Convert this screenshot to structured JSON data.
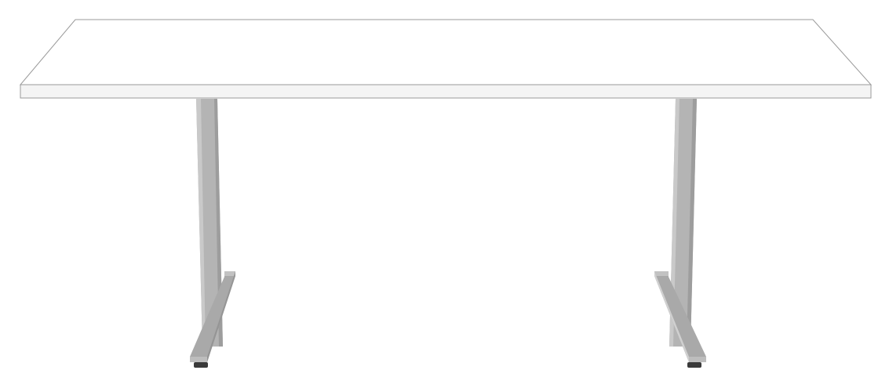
{
  "image": {
    "subject": "product-photo-table",
    "colors": {
      "background": "#ffffff",
      "tabletop": "#ffffff",
      "tabletop_edge": "#f4f4f4",
      "outline": "#9a9a9a",
      "leg": "#b2b2b2",
      "leg_shade": "#9b9b9b",
      "leg_highlight": "#c8c8c8",
      "glide": "#3a3a3a"
    }
  }
}
